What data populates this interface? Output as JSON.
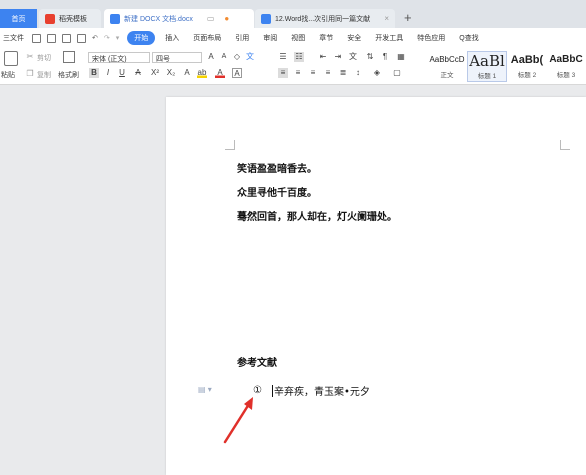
{
  "tabs": {
    "home": "首页",
    "templates": "稻壳模板",
    "doc": "新建 DOCX 文档.docx",
    "doc2": "12.Word找...次引用同一篇文献",
    "new_tab": "+"
  },
  "menu": {
    "file": "三文件",
    "items": [
      "开始",
      "插入",
      "页面布局",
      "引用",
      "审阅",
      "视图",
      "章节",
      "安全",
      "开发工具",
      "特色应用"
    ],
    "search": "Q查找"
  },
  "ribbon": {
    "paste": "粘贴",
    "cut": "剪切",
    "copy": "复制",
    "format_painter": "格式刷",
    "font_name": "宋体 (正文)",
    "font_size": "四号",
    "styles": [
      {
        "preview": "AaBbCcD",
        "name": "正文"
      },
      {
        "preview": "AaBl",
        "name": "标题 1"
      },
      {
        "preview": "AaBb(",
        "name": "标题 2"
      },
      {
        "preview": "AaBbC",
        "name": "标题 3"
      }
    ]
  },
  "document": {
    "lines": [
      "笑语盈盈暗香去。",
      "众里寻他千百度。",
      "蓦然回首，那人却在，灯火阑珊处。"
    ],
    "ref_heading": "参考文献",
    "ref_num": "①",
    "ref_text": "辛弃疾，青玉案•元夕"
  },
  "colors": {
    "accent": "#3d83f0",
    "arrow": "#e0302a"
  }
}
